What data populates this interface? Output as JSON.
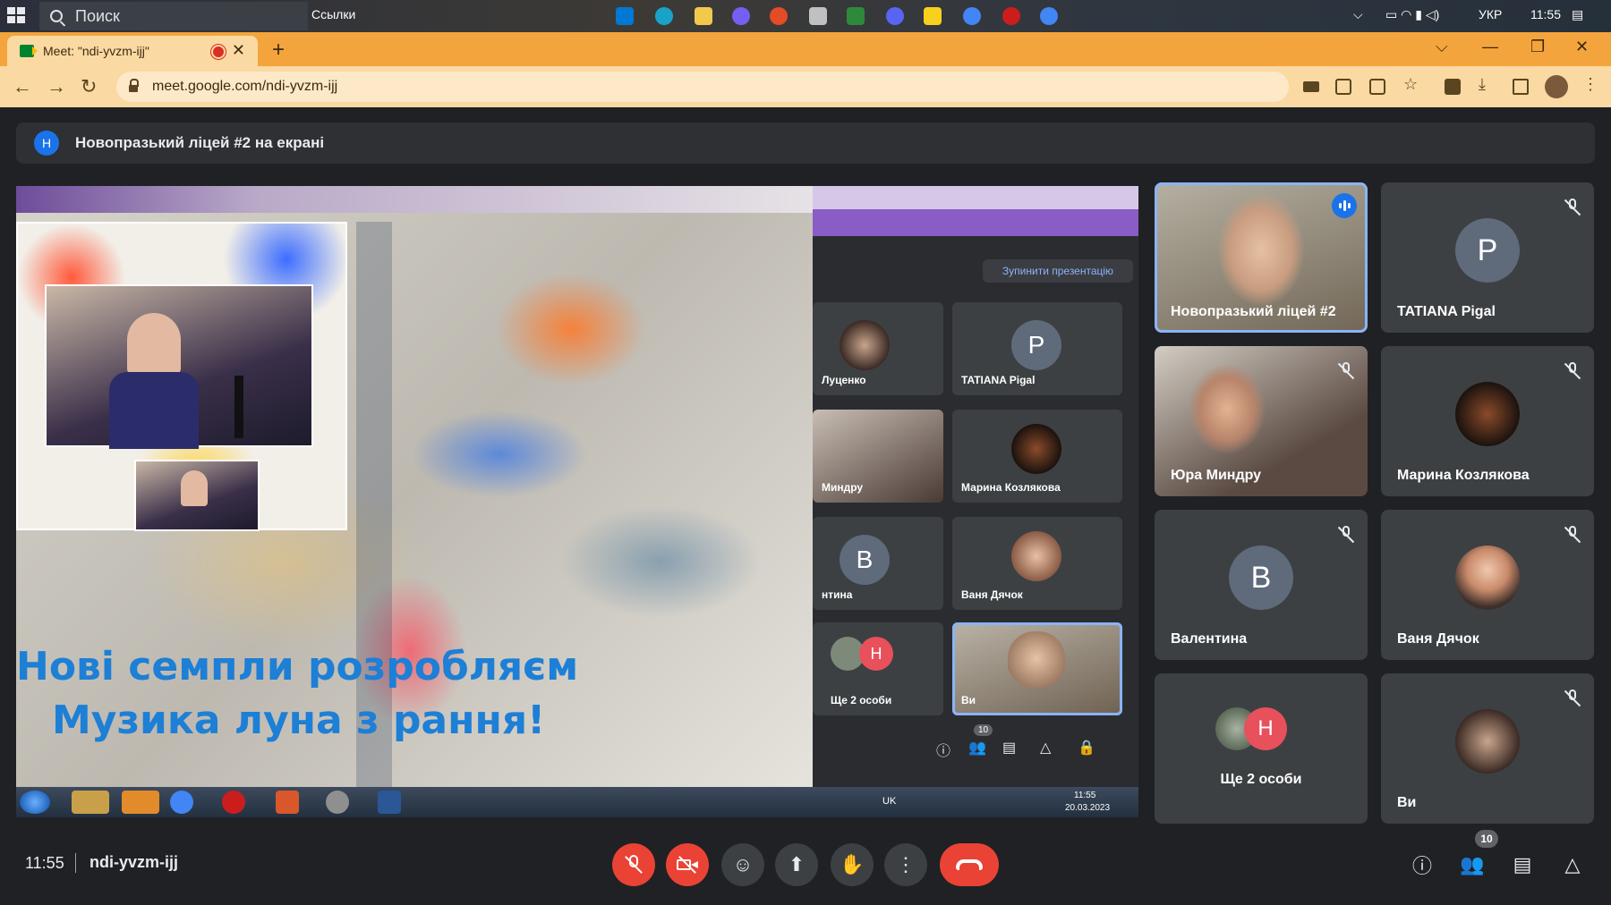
{
  "taskbar": {
    "search_label": "Поиск",
    "links_label": "Ссылки",
    "language": "УКР",
    "time": "11:55"
  },
  "browser": {
    "tab_title": "Meet: \"ndi-yvzm-ijj\"",
    "url": "meet.google.com/ndi-yvzm-ijj"
  },
  "banner": {
    "badge_letter": "Н",
    "text": "Новопразький ліцей #2 на екрані"
  },
  "presentation": {
    "slide_line1": "Нові семпли розробляєм",
    "slide_line2": "Музика луна з рання!",
    "shared_meet": {
      "stop_label": "Зупинити презентацію",
      "tiles": [
        {
          "name": "Луценко"
        },
        {
          "name": "TATIANA Pigal",
          "letter": "P"
        },
        {
          "name": "Миндру"
        },
        {
          "name": "Марина Козлякова"
        },
        {
          "name": "нтина",
          "letter": "В"
        },
        {
          "name": "Ваня Дячок"
        },
        {
          "name": "Ще 2 особи",
          "letter": "Н"
        },
        {
          "name": "Ви"
        }
      ],
      "participant_count": "10",
      "win_time": "11:55",
      "win_date": "20.03.2023",
      "win_lang": "UK"
    }
  },
  "participants": [
    {
      "name": "Новопразький ліцей #2",
      "type": "video",
      "speaking": true
    },
    {
      "name": "TATIANA Pigal",
      "type": "letter",
      "letter": "P",
      "color": "#5f6a7a",
      "muted": true
    },
    {
      "name": "Юра Миндру",
      "type": "video",
      "muted": true
    },
    {
      "name": "Марина Козлякова",
      "type": "photo",
      "muted": true
    },
    {
      "name": "Валентина",
      "type": "letter",
      "letter": "В",
      "color": "#5f6a7a",
      "muted": true
    },
    {
      "name": "Ваня Дячок",
      "type": "photo",
      "muted": true
    },
    {
      "name": "Ще 2 особи",
      "type": "group",
      "letter": "Н",
      "color": "#e8505b"
    },
    {
      "name": "Ви",
      "type": "photo",
      "muted": true
    }
  ],
  "bottom_bar": {
    "time": "11:55",
    "meeting_code": "ndi-yvzm-ijj",
    "participant_count": "10"
  },
  "colors": {
    "end_call": "#ea4335",
    "accent_blue": "#1a73e8",
    "tile_bg": "#3c4043",
    "tab_bar": "#f4a43c"
  }
}
